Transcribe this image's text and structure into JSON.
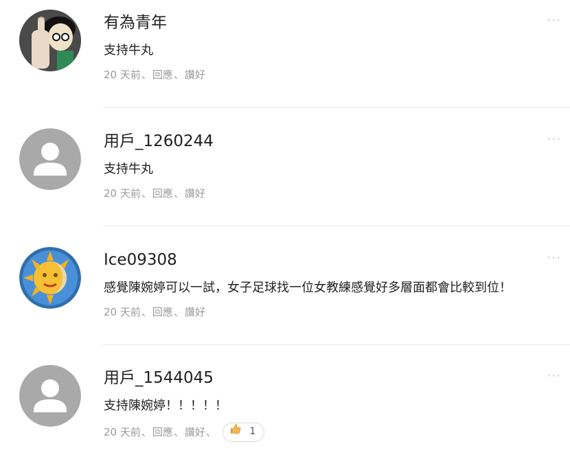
{
  "comments": [
    {
      "username": "有為青年",
      "text": "支持牛丸",
      "time": "20 天前",
      "reply": "回應",
      "like": "讚好",
      "avatar": "cartoon-avatar",
      "more": "···"
    },
    {
      "username": "用戶_1260244",
      "text": "支持牛丸",
      "time": "20 天前",
      "reply": "回應",
      "like": "讚好",
      "avatar": "default-user-avatar",
      "more": "···"
    },
    {
      "username": "Ice09308",
      "text": "感覺陳婉婷可以一試，女子足球找一位女教練感覺好多層面都會比較到位！",
      "time": "20 天前",
      "reply": "回應",
      "like": "讚好",
      "avatar": "sun-moon-avatar",
      "more": "···"
    },
    {
      "username": "用戶_1544045",
      "text": "支持陳婉婷！！！！！",
      "time": "20 天前",
      "reply": "回應",
      "like": "讚好",
      "avatar": "default-user-avatar",
      "more": "···",
      "like_count": "1",
      "like_icon": "thumbs-up-icon"
    }
  ],
  "separators": {
    "after_time": "、",
    "after_reply": "、",
    "after_like": "、"
  }
}
